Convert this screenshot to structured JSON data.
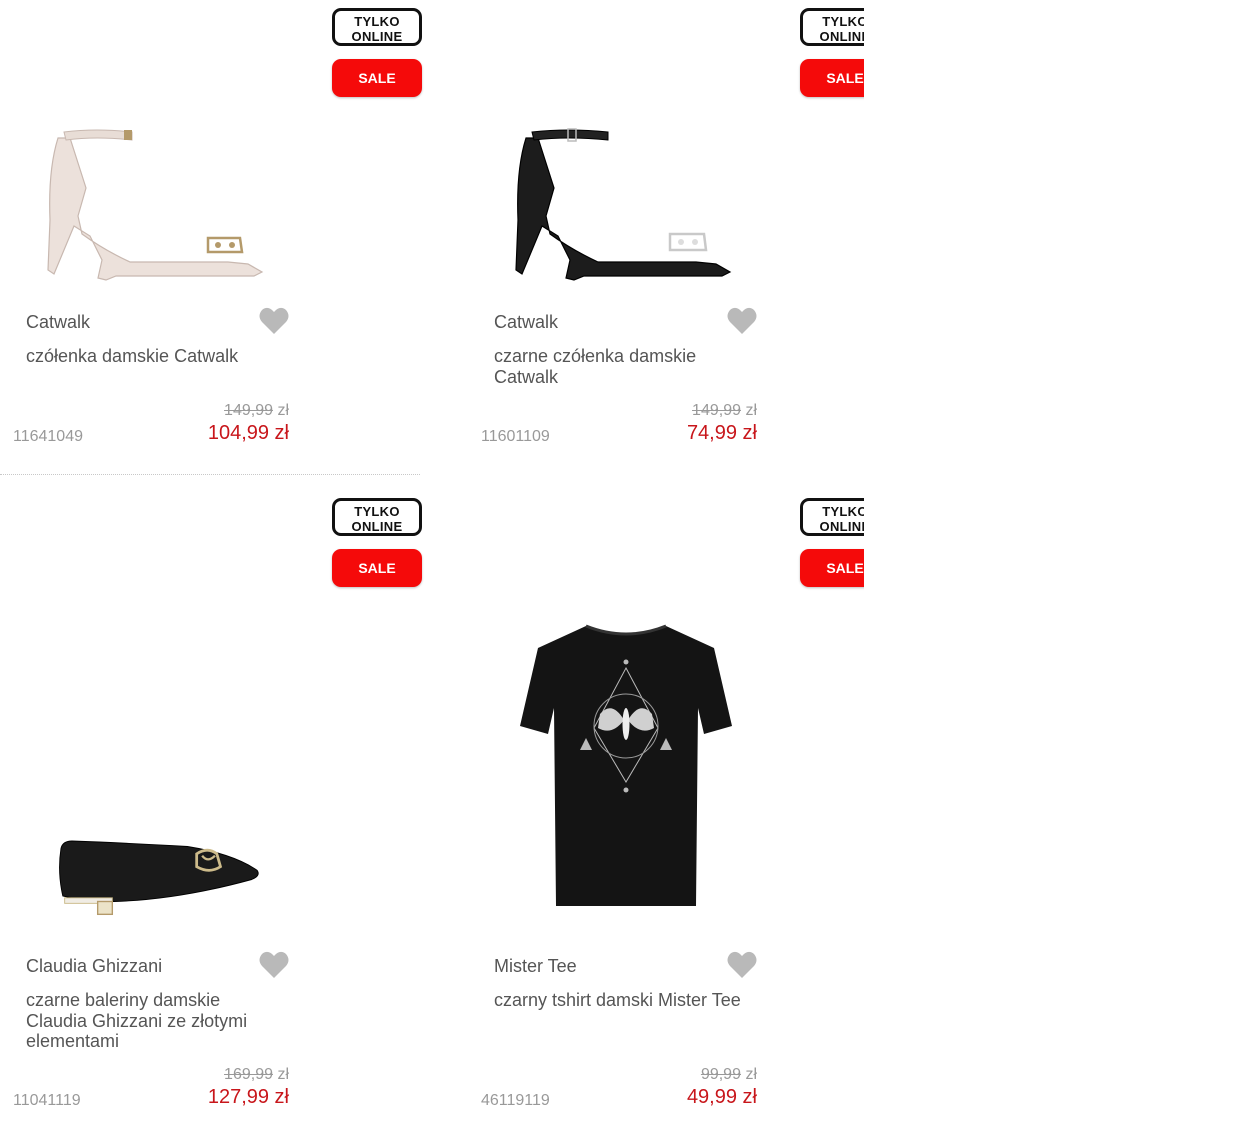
{
  "products": [
    {
      "badge_online": "TYLKO ONLINE",
      "badge_sale": "SALE",
      "brand": "Catwalk",
      "title": "czółenka damskie Catwalk",
      "old_price": "149,99",
      "currency": "zł",
      "new_price": "104,99 zł",
      "sku": "11641049",
      "image": "beige-ankle-strap-pump-shoe",
      "image_color": "#ece1db"
    },
    {
      "badge_online": "TYLKO ONLINE",
      "badge_sale": "SALE",
      "brand": "Catwalk",
      "title": "czarne czółenka damskie Catwalk",
      "old_price": "149,99",
      "currency": "zł",
      "new_price": "74,99 zł",
      "sku": "11601109",
      "image": "black-ankle-strap-pump-shoe",
      "image_color": "#1c1c1c"
    },
    {
      "badge_online": "TYLKO ONLINE",
      "badge_sale": "SALE",
      "brand": "Claudia Ghizzani",
      "title": "czarne baleriny damskie Claudia Ghizzani ze złotymi elementami",
      "old_price": "169,99",
      "currency": "zł",
      "new_price": "127,99 zł",
      "sku": "11041119",
      "image": "black-ballerina-flat-shoe",
      "image_color": "#1a1a1a"
    },
    {
      "badge_online": "TYLKO ONLINE",
      "badge_sale": "SALE",
      "brand": "Mister Tee",
      "title": "czarny tshirt damski Mister Tee",
      "old_price": "99,99",
      "currency": "zł",
      "new_price": "49,99 zł",
      "sku": "46119119",
      "image": "black-tshirt-moth-print",
      "image_color": "#141414"
    }
  ],
  "colors": {
    "sale_badge": "#f50a0a",
    "new_price": "#c8161b",
    "heart_icon": "#b9b9b9"
  }
}
